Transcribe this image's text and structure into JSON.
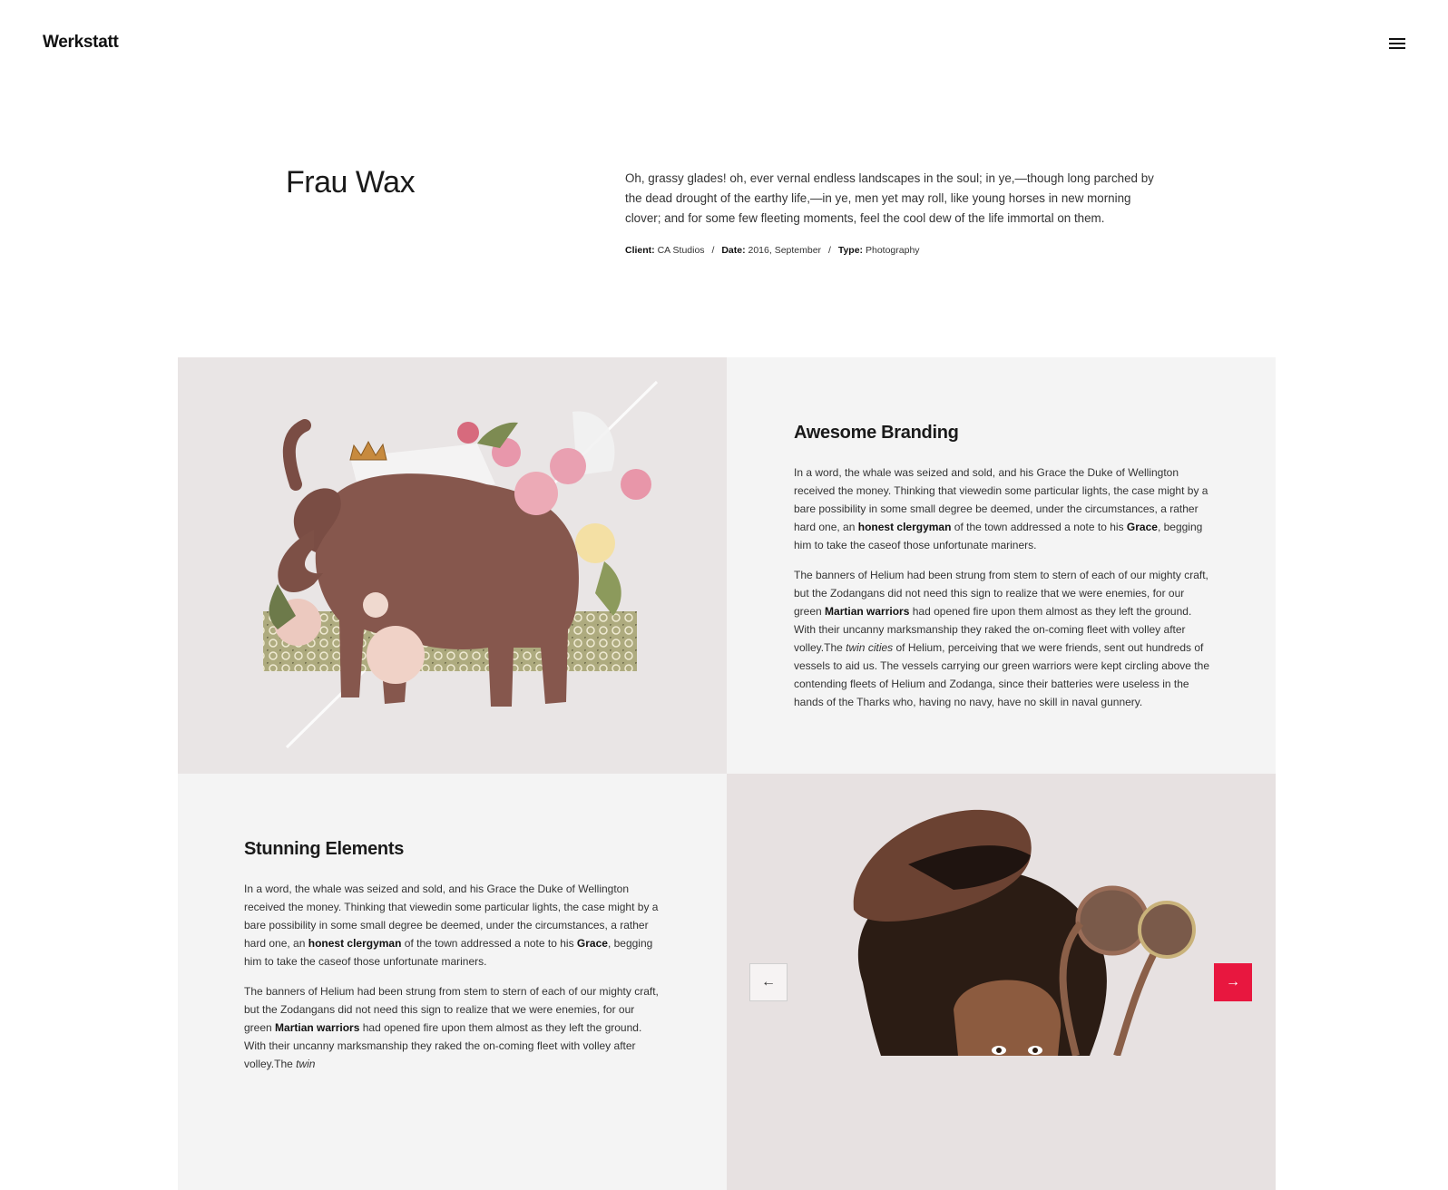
{
  "header": {
    "logo": "Werkstatt",
    "menu_icon": "hamburger-menu-icon"
  },
  "project": {
    "title": "Frau Wax",
    "intro": "Oh, grassy glades! oh, ever vernal endless landscapes in the soul; in ye,—though long parched by the dead drought of the earthy life,—in ye, men yet may roll, like young horses in new morning clover; and for some few fleeting moments, feel the cool dew of the life immortal on them.",
    "meta": {
      "client_label": "Client:",
      "client_value": "CA Studios",
      "date_label": "Date:",
      "date_value": "2016, September",
      "type_label": "Type:",
      "type_value": "Photography",
      "separator": "/"
    }
  },
  "sections": [
    {
      "heading": "Awesome Branding",
      "p1_a": "In a word, the whale was seized and sold, and his Grace the Duke of Wellington received the money. Thinking that viewedin some particular lights, the case might by a bare possibility in some small degree be deemed, under the circumstances, a rather hard one, an ",
      "p1_b1": "honest clergyman",
      "p1_c": " of the town addressed a note to his ",
      "p1_b2": "Grace",
      "p1_d": ", begging him to take the caseof those unfortunate mariners.",
      "p2_a": "The banners of Helium had been strung from stem to stern of each of our mighty craft, but the Zodangans did not need this sign to realize that we were enemies, for our green ",
      "p2_b": "Martian warriors",
      "p2_c": " had opened fire upon them almost as they left the ground. With their uncanny marksmanship they raked the on-coming fleet with volley after volley.The ",
      "p2_i": "twin cities",
      "p2_d": " of Helium, perceiving that we were friends, sent out hundreds of vessels to aid us. The vessels carrying our green warriors were kept circling above the contending fleets of Helium and Zodanga, since their batteries were useless in the hands of the Tharks who, having no navy, have no skill in naval gunnery."
    },
    {
      "heading": "Stunning Elements",
      "p1_a": "In a word, the whale was seized and sold, and his Grace the Duke of Wellington received the money. Thinking that viewedin some particular lights, the case might by a bare possibility in some small degree be deemed, under the circumstances, a rather hard one, an ",
      "p1_b1": "honest clergyman",
      "p1_c": " of the town addressed a note to his ",
      "p1_b2": "Grace",
      "p1_d": ", begging him to take the caseof those unfortunate mariners.",
      "p2_a": "The banners of Helium had been strung from stem to stern of each of our mighty craft, but the Zodangans did not need this sign to realize that we were enemies, for our green ",
      "p2_b": "Martian warriors",
      "p2_c": " had opened fire upon them almost as they left the ground. With their uncanny marksmanship they raked the on-coming fleet with volley after volley.The ",
      "p2_i": "twin"
    }
  ],
  "slider": {
    "prev_label": "←",
    "next_label": "→",
    "accent": "#e8173f"
  },
  "images": {
    "elephant": "elephant-collage-illustration",
    "portrait": "woman-with-cap-and-sunglasses-photo"
  }
}
